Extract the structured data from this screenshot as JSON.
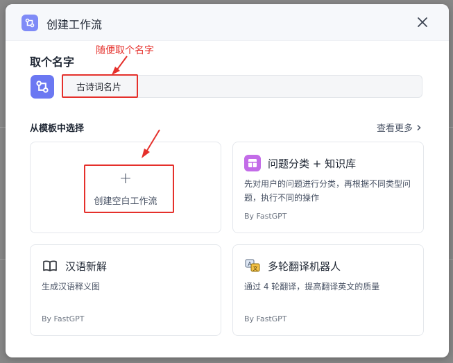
{
  "dialog": {
    "title": "创建工作流",
    "close_icon": "close-icon"
  },
  "name_section": {
    "label": "取个名字",
    "input_value": "古诗词名片"
  },
  "template_section": {
    "label": "从模板中选择",
    "see_more": "查看更多",
    "blank": {
      "plus": "+",
      "label": "创建空白工作流"
    },
    "templates": [
      {
        "title": "问题分类 + 知识库",
        "description": "先对用户的问题进行分类，再根据不同类型问题，执行不同的操作",
        "author": "By FastGPT"
      },
      {
        "title": "汉语新解",
        "description": "生成汉语释义图",
        "author": "By FastGPT"
      },
      {
        "title": "多轮翻译机器人",
        "description": "通过 4 轮翻译，提高翻译英文的质量",
        "author": "By FastGPT"
      }
    ]
  },
  "annotations": {
    "name_hint": "随便取个名字"
  },
  "colors": {
    "accent": "#6b78f2",
    "annotation_red": "#e5302b"
  }
}
